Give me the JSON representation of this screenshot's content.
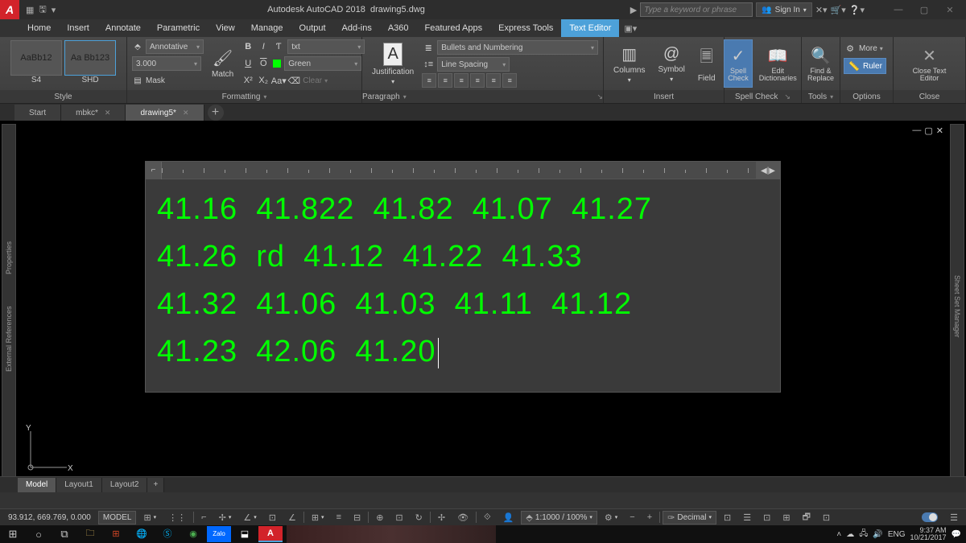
{
  "app": {
    "title": "Autodesk AutoCAD 2018",
    "file": "drawing5.dwg",
    "search_placeholder": "Type a keyword or phrase",
    "signin": "Sign In"
  },
  "menu": [
    "Home",
    "Insert",
    "Annotate",
    "Parametric",
    "View",
    "Manage",
    "Output",
    "Add-ins",
    "A360",
    "Featured Apps",
    "Express Tools",
    "Text Editor"
  ],
  "menu_active": 11,
  "ribbon": {
    "style": {
      "label": "Style",
      "s1": "AaBb12",
      "s2": "Aa Bb123",
      "n1": "S4",
      "n2": "SHD"
    },
    "fmt": {
      "label": "Formatting",
      "annotative": "Annotative",
      "height": "3.000",
      "mask": "Mask",
      "match": "Match",
      "layer": "txt",
      "color": "Green",
      "clear": "Clear"
    },
    "just": {
      "label": "Justification"
    },
    "para": {
      "label": "Paragraph",
      "bullets": "Bullets and Numbering",
      "spacing": "Line Spacing"
    },
    "insert": {
      "label": "Insert",
      "columns": "Columns",
      "symbol": "Symbol",
      "field": "Field"
    },
    "spell": {
      "label": "Spell Check",
      "check": "Spell Check",
      "dict": "Edit Dictionaries"
    },
    "tools": {
      "label": "Tools",
      "find": "Find & Replace"
    },
    "options": {
      "label": "Options",
      "more": "More",
      "ruler": "Ruler"
    },
    "close": {
      "label": "Close",
      "btn": "Close Text Editor"
    }
  },
  "doctabs": [
    "Start",
    "mbkc*",
    "drawing5*"
  ],
  "doctab_active": 2,
  "text_lines": [
    "41.16  41.822  41.82  41.07  41.27",
    "41.26  rd  41.12  41.22  41.33",
    "41.32  41.06  41.03  41.11  41.12",
    "41.23  42.06  41.20"
  ],
  "layouts": [
    "Model",
    "Layout1",
    "Layout2"
  ],
  "layout_active": 0,
  "status": {
    "coords": "93.912, 669.769, 0.000",
    "modelbtn": "MODEL",
    "scale": "1:1000 / 100%",
    "units": "Decimal"
  },
  "sidepanels": {
    "left1": "External References",
    "left2": "Properties",
    "right": "Sheet Set Manager"
  },
  "tray": {
    "lang": "ENG",
    "time": "9:37 AM",
    "date": "10/21/2017"
  }
}
